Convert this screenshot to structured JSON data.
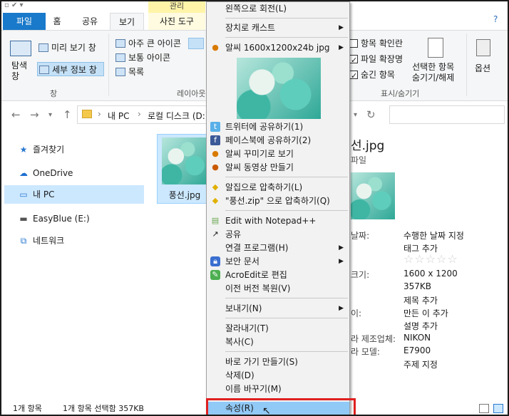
{
  "ribbon": {
    "tabs": [
      "파일",
      "홈",
      "공유",
      "보기",
      "사진 도구"
    ],
    "context_tab_header": "관리",
    "view_group": {
      "nav_pane_label": "탐색\n창",
      "preview_pane": "미리 보기 창",
      "details_pane": "세부 정보 창",
      "group_label": "창"
    },
    "layout_group": {
      "items": [
        "아주 큰 아이콘",
        "보통 아이콘",
        "목록"
      ],
      "group_label": "레이아웃"
    },
    "show_hide_group": {
      "item_checkbox": "항목 확인란",
      "file_ext": "파일 확장명",
      "hidden_items": "숨긴 항목",
      "hide_selected": "선택한 항목\n숨기기/해제",
      "group_label": "표시/숨기기"
    },
    "options": "옵션"
  },
  "nav": {
    "path": [
      "내 PC",
      "로컬 디스크 (D:)"
    ],
    "separator": "›"
  },
  "sidebar": {
    "items": [
      {
        "label": "즐겨찾기",
        "icon": "star-icon"
      },
      {
        "label": "OneDrive",
        "icon": "cloud-icon"
      },
      {
        "label": "내 PC",
        "icon": "computer-icon"
      },
      {
        "label": "EasyBlue (E:)",
        "icon": "drive-icon"
      },
      {
        "label": "네트워크",
        "icon": "network-icon"
      }
    ]
  },
  "file": {
    "name": "풍선.jpg"
  },
  "details": {
    "title_fragment": "선.jpg",
    "type_fragment": "파일",
    "rows": [
      {
        "label": "날짜:",
        "value": "수행한 날짜 지정"
      },
      {
        "label": "",
        "value": "태그 추가"
      },
      {
        "label": "",
        "value": "☆☆☆☆☆"
      },
      {
        "label": "크기:",
        "value": "1600 x 1200"
      },
      {
        "label": "",
        "value": "357KB"
      },
      {
        "label": "",
        "value": "제목 추가"
      },
      {
        "label": "이:",
        "value": "만든 이 추가"
      },
      {
        "label": "",
        "value": "설명 추가"
      },
      {
        "label": "라 제조업체:",
        "value": "NIKON"
      },
      {
        "label": "라 모델:",
        "value": "E7900"
      },
      {
        "label": "",
        "value": "주제 지정"
      }
    ]
  },
  "status": {
    "count": "1개 항목",
    "selected": "1개 항목 선택함 357KB"
  },
  "menu": {
    "items": [
      {
        "label": "왼쪽으로 회전(L)"
      },
      {
        "label": "장치로 캐스트",
        "arrow": true
      },
      {
        "label": "알씨 1600x1200x24b jpg",
        "arrow": true,
        "icon": "alsee-icon"
      },
      {
        "label": "트위터에 공유하기(1)",
        "icon": "twitter-icon"
      },
      {
        "label": "페이스북에 공유하기(2)",
        "icon": "facebook-icon"
      },
      {
        "label": "알씨 꾸미기로 보기",
        "icon": "alsee-decorate-icon"
      },
      {
        "label": "알씨 동영상 만들기",
        "icon": "alsee-video-icon"
      },
      {
        "label": "알집으로 압축하기(L)",
        "icon": "alzip-icon"
      },
      {
        "label": "\"풍선.zip\" 으로 압축하기(Q)",
        "icon": "alzip-icon"
      },
      {
        "label": "Edit with Notepad++",
        "icon": "notepad-icon"
      },
      {
        "label": "공유",
        "icon": "share-icon"
      },
      {
        "label": "연결 프로그램(H)",
        "arrow": true
      },
      {
        "label": "보안 문서",
        "arrow": true,
        "icon": "lock-icon"
      },
      {
        "label": "AcroEdit로 편집",
        "icon": "acroedit-icon"
      },
      {
        "label": "이전 버전 복원(V)"
      },
      {
        "label": "보내기(N)",
        "arrow": true
      },
      {
        "label": "잘라내기(T)"
      },
      {
        "label": "복사(C)"
      },
      {
        "label": "바로 가기 만들기(S)"
      },
      {
        "label": "삭제(D)"
      },
      {
        "label": "이름 바꾸기(M)"
      },
      {
        "label": "속성(R)"
      }
    ]
  }
}
